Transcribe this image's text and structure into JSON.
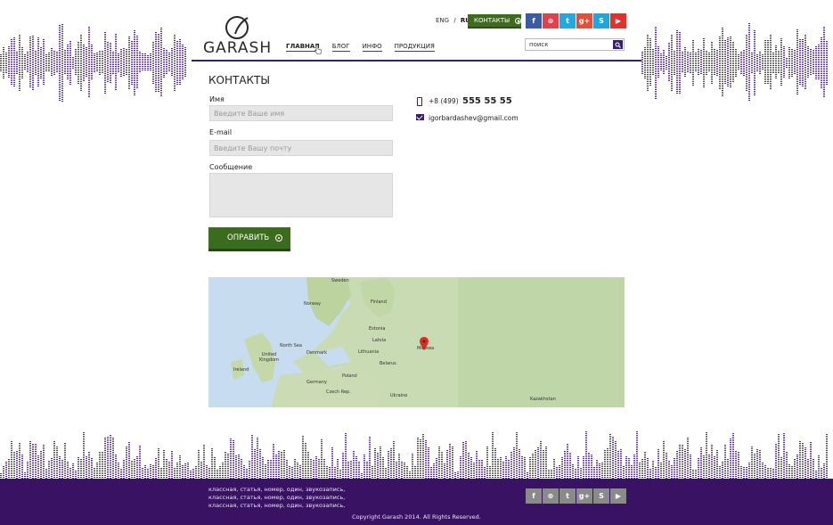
{
  "header": {
    "logo_text": "GARASH",
    "lang_eng": "ENG",
    "lang_sep": "/",
    "lang_ru": "RU",
    "contacts_button": "КОНТАКТЫ",
    "nav": [
      {
        "label": "ГЛАВНАЯ"
      },
      {
        "label": "БЛОГ"
      },
      {
        "label": "ИНФО"
      },
      {
        "label": "ПРОДУКЦИЯ"
      }
    ],
    "search_value": "поиск",
    "socials": [
      {
        "name": "facebook",
        "glyph": "f",
        "color": "#3b5ba6"
      },
      {
        "name": "pinterest",
        "glyph": "⊛",
        "color": "#e0414a"
      },
      {
        "name": "twitter",
        "glyph": "t",
        "color": "#21a9e1"
      },
      {
        "name": "google-plus",
        "glyph": "g+",
        "color": "#e0503a"
      },
      {
        "name": "skype",
        "glyph": "S",
        "color": "#1fa6e0"
      },
      {
        "name": "youtube",
        "glyph": "▶",
        "color": "#e2302a"
      }
    ]
  },
  "form": {
    "title": "КОНТАКТЫ",
    "name_label": "Имя",
    "name_placeholder": "Введите Ваше имя",
    "email_label": "E-mail",
    "email_placeholder": "Введите Вашу почту",
    "message_label": "Сообщение",
    "submit_label": "ОПРАВИТЬ"
  },
  "contact": {
    "phone_prefix": "+8 (499)",
    "phone_number": "555 55 55",
    "email": "igorbardashev@gmail.com"
  },
  "map": {
    "labels": [
      "Sweden",
      "Finland",
      "Norway",
      "Estonia",
      "Latvia",
      "Lithuania",
      "Denmark",
      "United Kingdom",
      "Ireland",
      "North Sea",
      "Belarus",
      "Poland",
      "Germany",
      "Ukraine",
      "Czech Rep.",
      "Kazakhstan",
      "Москва"
    ]
  },
  "footer": {
    "lines": [
      "классная, статья, номер, один, звукозапись,",
      "классная, статья, номер, один, звукозапись,",
      "классная, статья, номер, один, звукозапись,"
    ],
    "copyright": "Copyright Garash 2014. All Rights Reserved.",
    "socials": [
      {
        "name": "facebook",
        "glyph": "f"
      },
      {
        "name": "pinterest",
        "glyph": "⊛"
      },
      {
        "name": "twitter",
        "glyph": "t"
      },
      {
        "name": "google-plus",
        "glyph": "g+"
      },
      {
        "name": "skype",
        "glyph": "S"
      },
      {
        "name": "youtube",
        "glyph": "▶"
      }
    ]
  }
}
